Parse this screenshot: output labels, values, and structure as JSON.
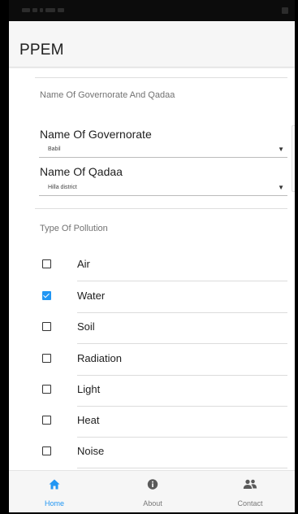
{
  "app": {
    "title": "PPEM"
  },
  "form": {
    "location_section_header": "Name Of Governorate And Qadaa",
    "governorate_label": "Name Of Governorate",
    "governorate_value": "Babil",
    "qadaa_label": "Name Of Qadaa",
    "qadaa_value": "Hilla district",
    "pollution_section_header": "Type Of Pollution",
    "pollution_types": [
      {
        "label": "Air",
        "checked": false
      },
      {
        "label": "Water",
        "checked": true
      },
      {
        "label": "Soil",
        "checked": false
      },
      {
        "label": "Radiation",
        "checked": false
      },
      {
        "label": "Light",
        "checked": false
      },
      {
        "label": "Heat",
        "checked": false
      },
      {
        "label": "Noise",
        "checked": false
      }
    ]
  },
  "tabs": [
    {
      "label": "Home",
      "icon": "home-icon",
      "active": true
    },
    {
      "label": "About",
      "icon": "info-icon",
      "active": false
    },
    {
      "label": "Contact",
      "icon": "people-icon",
      "active": false
    }
  ],
  "colors": {
    "accent": "#2196F3",
    "app_bar": "#f6f6f6",
    "tab_inactive": "#787878"
  }
}
